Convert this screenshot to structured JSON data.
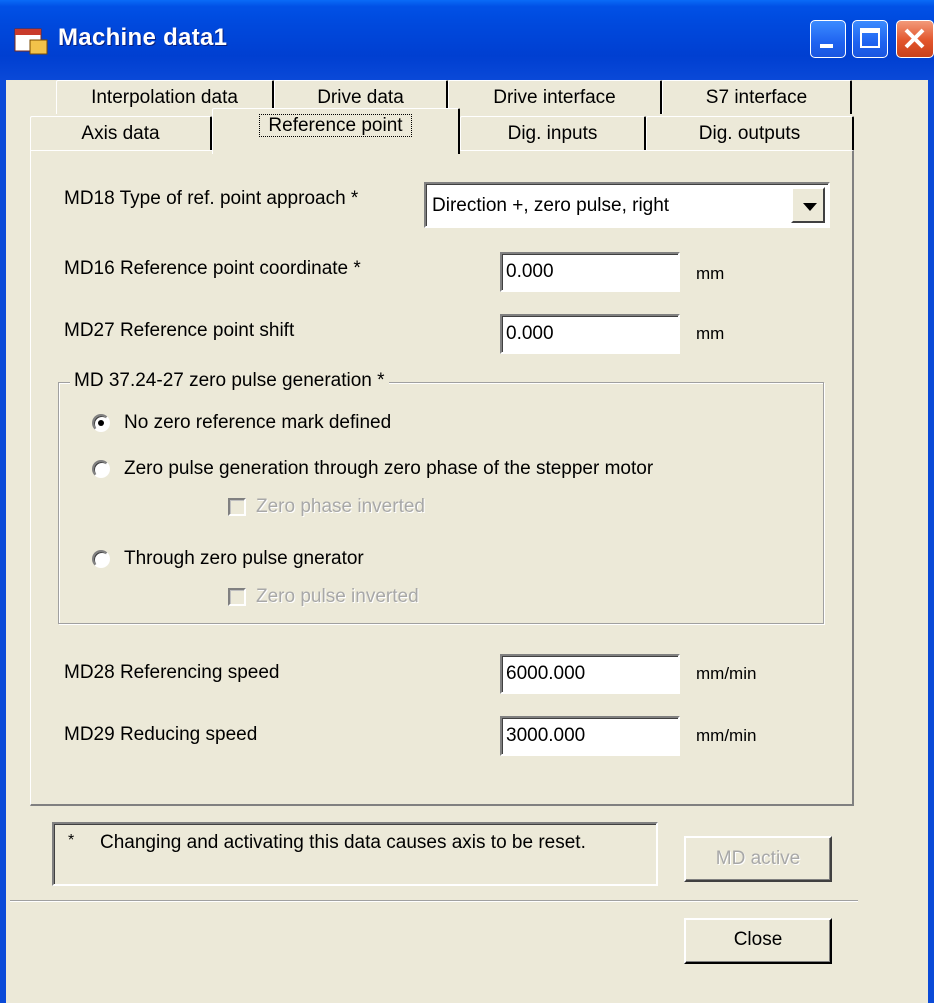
{
  "window": {
    "title": "Machine data1",
    "icons": {
      "app": "siemens-app-icon",
      "minimize": "minimize-icon",
      "maximize": "maximize-icon",
      "close": "close-icon"
    }
  },
  "tabs": {
    "row_back": [
      "Interpolation data",
      "Drive data",
      "Drive interface",
      "S7 interface"
    ],
    "row_front": [
      "Axis data",
      "Reference point",
      "Dig. inputs",
      "Dig. outputs"
    ],
    "active": "Reference point"
  },
  "page": {
    "md18_label": "MD18 Type of ref. point approach *",
    "md18_value": "Direction +, zero pulse, right",
    "md16_label": "MD16 Reference point coordinate *",
    "md16_value": "0.000",
    "md16_unit": "mm",
    "md27_label": "MD27 Reference point shift",
    "md27_value": "0.000",
    "md27_unit": "mm",
    "group_title": "MD 37.24-27 zero pulse generation *",
    "radio_none": "No zero reference mark defined",
    "radio_stepper": "Zero pulse generation through zero phase of the stepper motor",
    "check_zero_phase": "Zero phase inverted",
    "radio_generator": "Through zero pulse gnerator",
    "check_zero_pulse": "Zero pulse inverted",
    "selected_radio": "No zero reference mark defined",
    "md28_label": "MD28 Referencing speed",
    "md28_value": "6000.000",
    "md28_unit": "mm/min",
    "md29_label": "MD29 Reducing speed",
    "md29_value": "3000.000",
    "md29_unit": "mm/min"
  },
  "footer": {
    "note_star": "*",
    "note": "Changing and activating this data causes axis to be reset.",
    "md_active_button": "MD active",
    "close_button": "Close"
  },
  "colors": {
    "titlebar": "#0049dd",
    "face": "#ece9d8",
    "close_button": "#e2552c"
  }
}
